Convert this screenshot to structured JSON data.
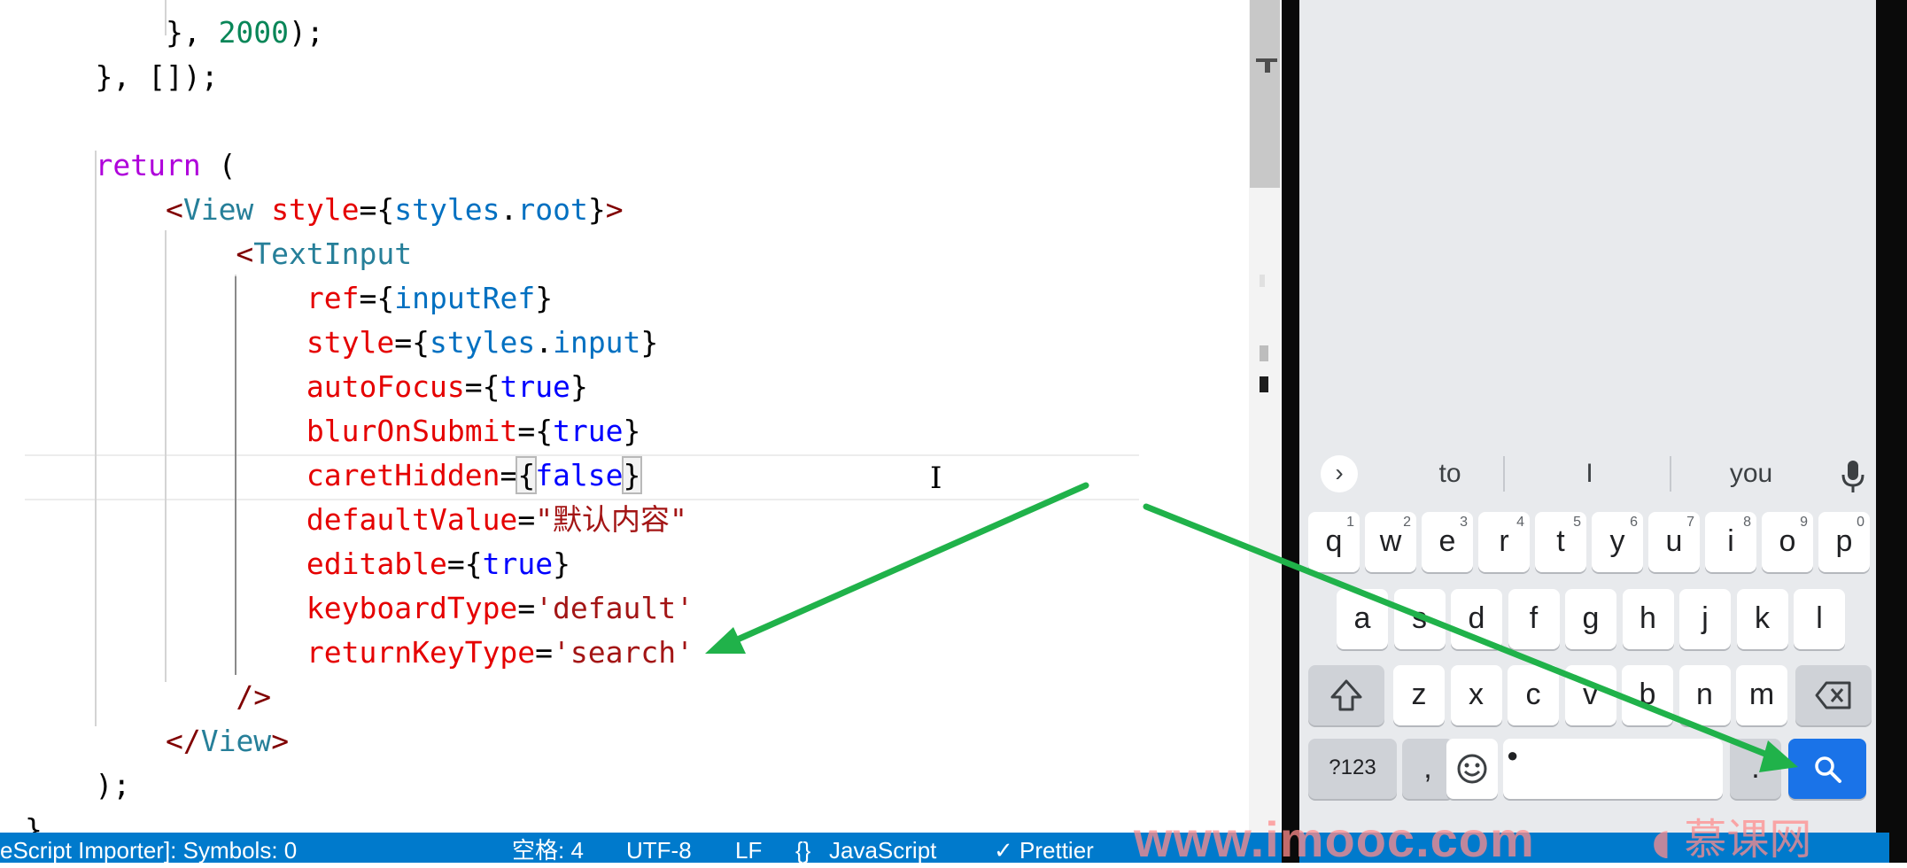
{
  "editor": {
    "lines": [
      {
        "indent": "        ",
        "parts": [
          [
            "pun",
            "}, "
          ],
          [
            "num",
            "2000"
          ],
          [
            "pun",
            ");"
          ]
        ]
      },
      {
        "indent": "    ",
        "parts": [
          [
            "pun",
            "}, [])"
          ],
          [
            "pun",
            ";"
          ]
        ]
      },
      {
        "indent": "",
        "parts": []
      },
      {
        "indent": "    ",
        "parts": [
          [
            "kw",
            "return"
          ],
          [
            "pun",
            " ("
          ]
        ]
      },
      {
        "indent": "        ",
        "parts": [
          [
            "tagb",
            "<"
          ],
          [
            "tag",
            "View"
          ],
          [
            "pun",
            " "
          ],
          [
            "attr",
            "style"
          ],
          [
            "pun",
            "="
          ],
          [
            "pun",
            "{"
          ],
          [
            "var",
            "styles"
          ],
          [
            "pun",
            "."
          ],
          [
            "var",
            "root"
          ],
          [
            "pun",
            "}"
          ],
          [
            "tagb",
            ">"
          ]
        ]
      },
      {
        "indent": "            ",
        "parts": [
          [
            "tagb",
            "<"
          ],
          [
            "tag",
            "TextInput"
          ]
        ]
      },
      {
        "indent": "                ",
        "parts": [
          [
            "attr",
            "ref"
          ],
          [
            "pun",
            "="
          ],
          [
            "pun",
            "{"
          ],
          [
            "var",
            "inputRef"
          ],
          [
            "pun",
            "}"
          ]
        ]
      },
      {
        "indent": "                ",
        "parts": [
          [
            "attr",
            "style"
          ],
          [
            "pun",
            "="
          ],
          [
            "pun",
            "{"
          ],
          [
            "var",
            "styles"
          ],
          [
            "pun",
            "."
          ],
          [
            "var",
            "input"
          ],
          [
            "pun",
            "}"
          ]
        ]
      },
      {
        "indent": "                ",
        "parts": [
          [
            "attr",
            "autoFocus"
          ],
          [
            "pun",
            "="
          ],
          [
            "pun",
            "{"
          ],
          [
            "bool",
            "true"
          ],
          [
            "pun",
            "}"
          ]
        ]
      },
      {
        "indent": "                ",
        "parts": [
          [
            "attr",
            "blurOnSubmit"
          ],
          [
            "pun",
            "="
          ],
          [
            "pun",
            "{"
          ],
          [
            "bool",
            "true"
          ],
          [
            "pun",
            "}"
          ]
        ]
      },
      {
        "indent": "                ",
        "parts": [
          [
            "attr",
            "caretHidden"
          ],
          [
            "pun",
            "="
          ],
          [
            "match",
            "{"
          ],
          [
            "bool",
            "false"
          ],
          [
            "match",
            "}"
          ]
        ]
      },
      {
        "indent": "                ",
        "parts": [
          [
            "attr",
            "defaultValue"
          ],
          [
            "pun",
            "="
          ],
          [
            "str",
            "\"默认内容\""
          ]
        ]
      },
      {
        "indent": "                ",
        "parts": [
          [
            "attr",
            "editable"
          ],
          [
            "pun",
            "="
          ],
          [
            "pun",
            "{"
          ],
          [
            "bool",
            "true"
          ],
          [
            "pun",
            "}"
          ]
        ]
      },
      {
        "indent": "                ",
        "parts": [
          [
            "attr",
            "keyboardType"
          ],
          [
            "pun",
            "="
          ],
          [
            "str",
            "'default'"
          ]
        ]
      },
      {
        "indent": "                ",
        "parts": [
          [
            "attr",
            "returnKeyType"
          ],
          [
            "pun",
            "="
          ],
          [
            "str",
            "'search'"
          ]
        ]
      },
      {
        "indent": "            ",
        "parts": [
          [
            "tagb",
            "/>"
          ]
        ]
      },
      {
        "indent": "        ",
        "parts": [
          [
            "tagb",
            "</"
          ],
          [
            "tag",
            "View"
          ],
          [
            "tagb",
            ">"
          ]
        ]
      },
      {
        "indent": "    ",
        "parts": [
          [
            "pun",
            ");"
          ]
        ]
      },
      {
        "indent": "",
        "parts": [
          [
            "pun",
            "}"
          ]
        ]
      }
    ]
  },
  "keyboard": {
    "suggestions": [
      "to",
      "I",
      "you"
    ],
    "row1": [
      [
        "q",
        "1"
      ],
      [
        "w",
        "2"
      ],
      [
        "e",
        "3"
      ],
      [
        "r",
        "4"
      ],
      [
        "t",
        "5"
      ],
      [
        "y",
        "6"
      ],
      [
        "u",
        "7"
      ],
      [
        "i",
        "8"
      ],
      [
        "o",
        "9"
      ],
      [
        "p",
        "0"
      ]
    ],
    "row2": [
      "a",
      "s",
      "d",
      "f",
      "g",
      "h",
      "j",
      "k",
      "l"
    ],
    "row3": [
      "z",
      "x",
      "c",
      "v",
      "b",
      "n",
      "m"
    ],
    "mode_key": "?123",
    "comma_key": ",",
    "period_key": ".",
    "expand_glyph": "›"
  },
  "statusbar": {
    "left": "eScript Importer]: Symbols: 0",
    "spaces": "空格: 4",
    "encoding": "UTF-8",
    "eol": "LF",
    "lang_braces": "{}",
    "language": "JavaScript",
    "prettier": "✓ Prettier"
  },
  "watermark": {
    "url": "www.imooc.com",
    "brand": "慕课网"
  },
  "colors": {
    "accent_green": "#20b24a",
    "statusbar_blue": "#007acc",
    "search_key_blue": "#1a73e8"
  }
}
